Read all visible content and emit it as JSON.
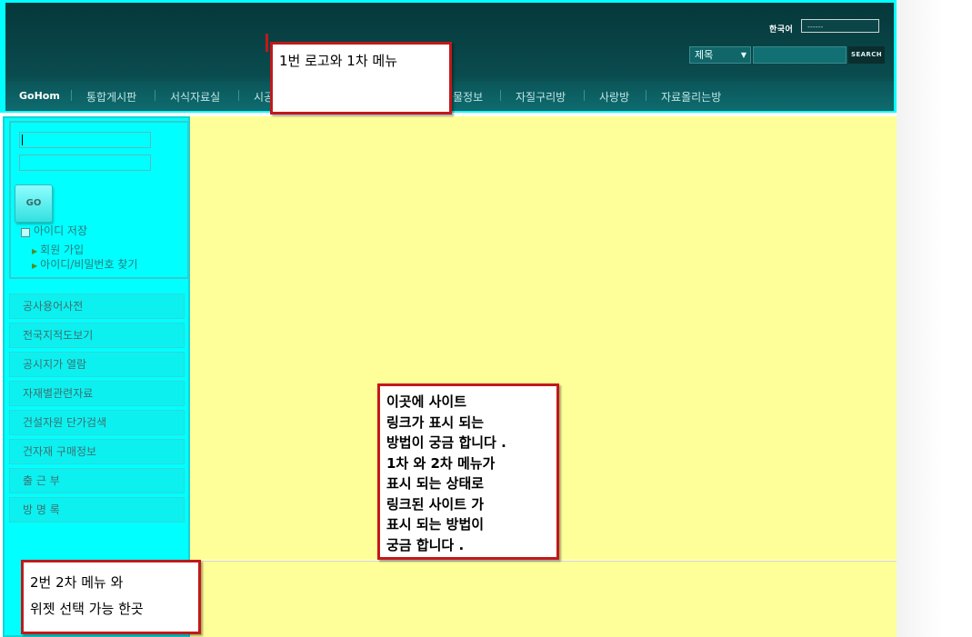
{
  "header": {
    "lang_label": "한국어",
    "lang_box_text": "------",
    "search_select": "제목",
    "search_button": "SEARCH"
  },
  "nav": {
    "items": [
      "GoHom",
      "통합게시판",
      "서식자료실",
      "시공",
      "물정보",
      "자질구리방",
      "사랑방",
      "자료올리는방"
    ]
  },
  "callouts": {
    "top": "1번 로고와 1차 메뉴",
    "center": [
      "이곳에 사이트",
      "링크가  표시 되는",
      "방법이 궁금 합니다 .",
      "1차 와 2차 메뉴가",
      "표시 되는 상태로",
      "링크된 사이트 가",
      "표시 되는 방법이",
      "궁금  합니다 ."
    ],
    "bottom": [
      "2번 2차 메뉴 와",
      "위젯 선택 가능 한곳"
    ]
  },
  "login": {
    "go_label": "GO",
    "save_id": "아이디 저장",
    "links": [
      "회원 가입",
      "아이디/비밀번호 찾기"
    ]
  },
  "sidebar_menu": [
    "공사용어사전",
    "전국지적도보기",
    "공시지가 열람",
    "자재별관련자료",
    "건설자원 단가검색",
    "건자재 구매정보",
    "출 근 부",
    "방 명 록"
  ]
}
